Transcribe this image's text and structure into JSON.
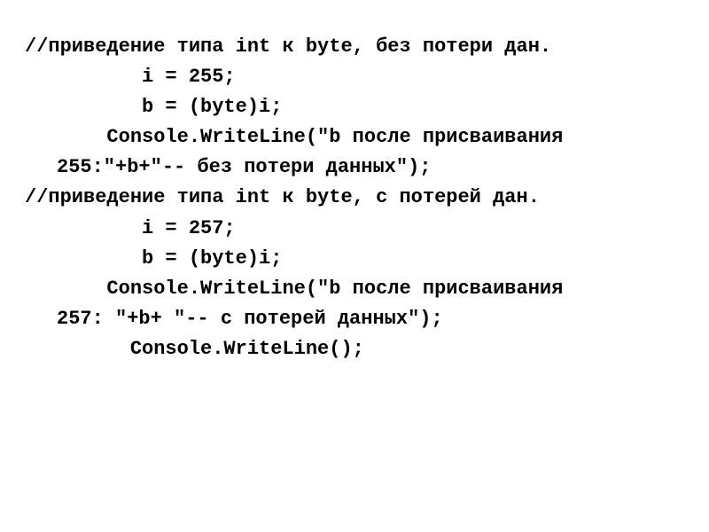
{
  "lines": {
    "l1": "//приведение типа int к byte, без потери дан.",
    "l2": "          i = 255;",
    "l3": "          b = (byte)i;",
    "l4": "       Console.WriteLine(\"b после присваивания",
    "l4b": "255:\"+b+\"-- без потери данных\");",
    "l5": "//приведение типа int к byte, с потерей дан.",
    "l6": "          i = 257;",
    "l7": "          b = (byte)i;",
    "l8": "       Console.WriteLine(\"b после присваивания",
    "l8b": "257: \"+b+ \"-- с потерей данных\");",
    "l9": "         Console.WriteLine();"
  }
}
